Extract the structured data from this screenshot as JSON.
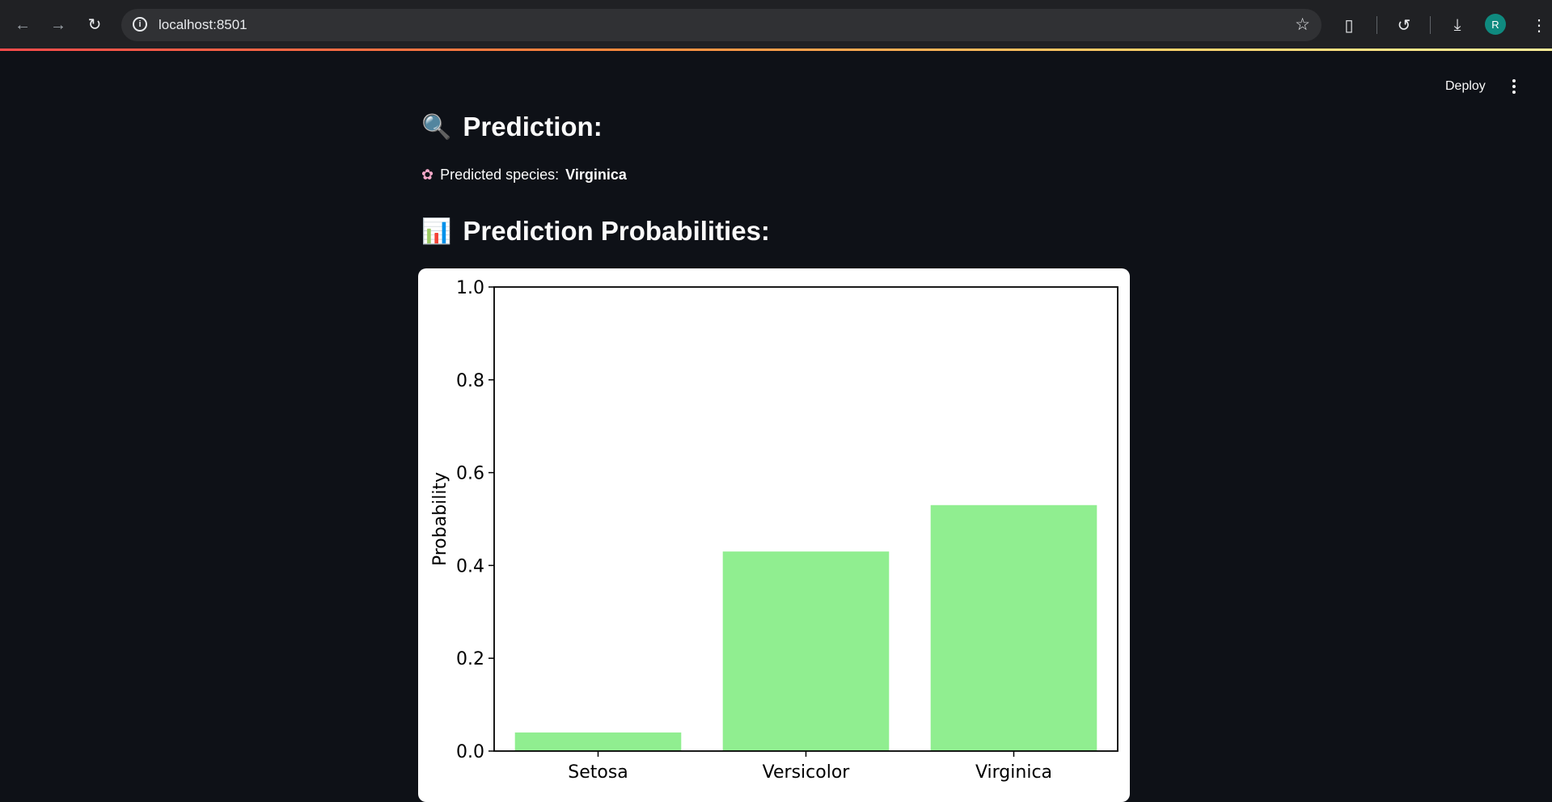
{
  "browser": {
    "url": "localhost:8501",
    "avatar_letter": "R",
    "icons": [
      "back-arrow-icon",
      "forward-arrow-icon",
      "reload-icon",
      "site-info-icon",
      "bookmark-star-icon",
      "extensions-icon",
      "history-icon",
      "downloads-icon"
    ]
  },
  "app_header": {
    "deploy_label": "Deploy",
    "menu_icon": "more-vertical-icon"
  },
  "prediction": {
    "icon": "magnifying-glass-icon",
    "heading": "Prediction:",
    "species_icon": "flower-icon",
    "species_prefix": "Predicted species:",
    "species_value": "Virginica"
  },
  "probabilities": {
    "icon": "bar-chart-icon",
    "heading": "Prediction Probabilities:"
  },
  "chart_data": {
    "type": "bar",
    "categories": [
      "Setosa",
      "Versicolor",
      "Virginica"
    ],
    "values": [
      0.04,
      0.43,
      0.53
    ],
    "ylabel": "Probability",
    "xlabel": "",
    "ylim": [
      0,
      1.0
    ],
    "yticks": [
      "0.0",
      "0.2",
      "0.4",
      "0.6",
      "0.8",
      "1.0"
    ],
    "bar_color": "#90ee90",
    "grid": false
  }
}
